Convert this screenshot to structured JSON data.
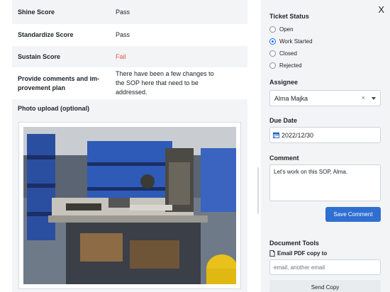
{
  "form": {
    "rows": [
      {
        "label": "Shine Score",
        "value": "Pass",
        "status": "pass"
      },
      {
        "label": "Standardize Score",
        "value": "Pass",
        "status": "pass"
      },
      {
        "label": "Sustain Score",
        "value": "Fail",
        "status": "fail"
      },
      {
        "label": "Provide comments and im-\nprovement plan",
        "value": "There have been a few changes to the SOP here that need to be addressed.",
        "status": "comment"
      }
    ],
    "photo_label": "Photo upload (optional)"
  },
  "ticket": {
    "close_label": "X",
    "status_title": "Ticket Status",
    "statuses": [
      {
        "label": "Open",
        "selected": false
      },
      {
        "label": "Work Started",
        "selected": true
      },
      {
        "label": "Closed",
        "selected": false
      },
      {
        "label": "Rejected",
        "selected": false
      }
    ],
    "assignee_title": "Assignee",
    "assignee_value": "Alma Majka",
    "due_date_title": "Due Date",
    "due_date_value": "2022/12/30",
    "comment_title": "Comment",
    "comment_value": "Let's work on this SOP, Alma.",
    "save_label": "Save Comment",
    "doc_tools_title": "Document Tools",
    "email_pdf_label": "Email PDF copy to",
    "email_placeholder": "email, another email",
    "send_label": "Send Copy"
  },
  "colors": {
    "fail": "#e8553e",
    "primary": "#2f6fd0",
    "panel_bg": "#f3f4f6",
    "row_shade": "#f2f4f6"
  }
}
